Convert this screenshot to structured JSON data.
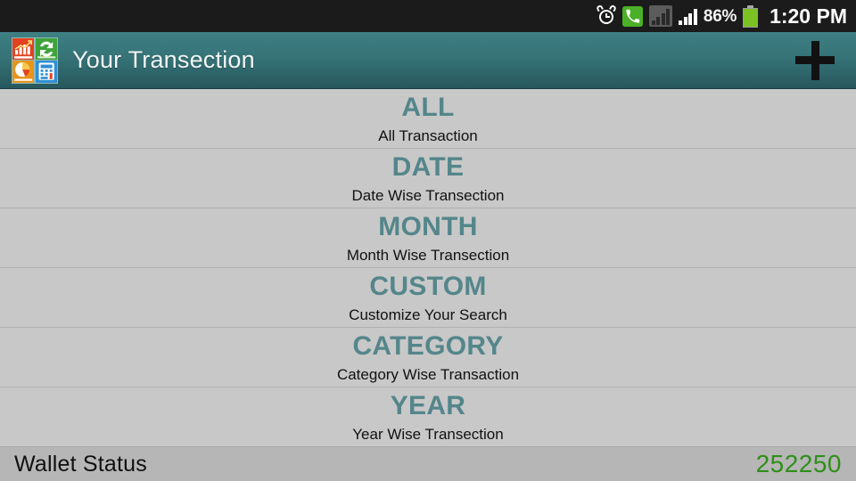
{
  "statusbar": {
    "alarm_icon": "alarm-clock-icon",
    "phone_icon": "phone-call-icon",
    "signal1_icon": "signal-bars-dim-icon",
    "signal2_icon": "signal-bars-icon",
    "battery_percent": "86%",
    "battery_icon": "battery-icon",
    "time": "1:20 PM"
  },
  "header": {
    "app_icon": "app-logo-icon",
    "title": "Your Transection",
    "add_button_label": "+",
    "gradient_top": "#3e8084",
    "gradient_bottom": "#27585d"
  },
  "list": {
    "rows": [
      {
        "title": "ALL",
        "subtitle": "All Transaction"
      },
      {
        "title": "DATE",
        "subtitle": "Date Wise Transection"
      },
      {
        "title": "MONTH",
        "subtitle": "Month Wise Transection"
      },
      {
        "title": "CUSTOM",
        "subtitle": "Customize Your Search"
      },
      {
        "title": "CATEGORY",
        "subtitle": "Category Wise Transaction"
      },
      {
        "title": "YEAR",
        "subtitle": "Year Wise Transection"
      }
    ],
    "title_color": "#54868b",
    "background_color": "#c8c8c8"
  },
  "bottombar": {
    "label": "Wallet Status",
    "amount": "252250",
    "amount_color": "#2f8f18"
  }
}
